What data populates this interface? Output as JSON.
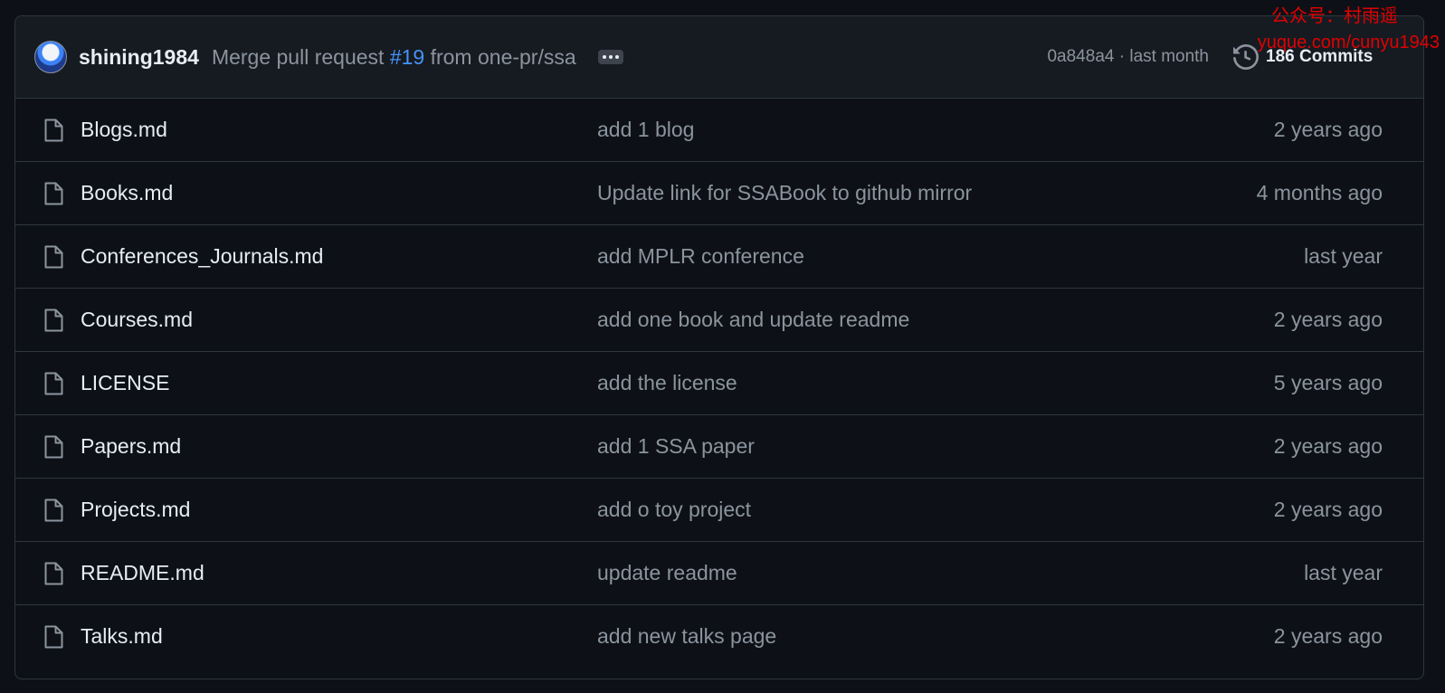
{
  "latest_commit": {
    "author": "shining1984",
    "message_prefix": "Merge pull request",
    "pr_number": "#19",
    "message_suffix": "from one-pr/ssa",
    "sha": "0a848a4",
    "separator": " · ",
    "time": "last month",
    "commits_label": "186 Commits"
  },
  "files": [
    {
      "name": "Blogs.md",
      "commit": "add 1 blog",
      "date": "2 years ago"
    },
    {
      "name": "Books.md",
      "commit": "Update link for SSABook to github mirror",
      "date": "4 months ago"
    },
    {
      "name": "Conferences_Journals.md",
      "commit": "add MPLR conference",
      "date": "last year"
    },
    {
      "name": "Courses.md",
      "commit": "add one book and update readme",
      "date": "2 years ago"
    },
    {
      "name": "LICENSE",
      "commit": "add the license",
      "date": "5 years ago"
    },
    {
      "name": "Papers.md",
      "commit": "add 1 SSA paper",
      "date": "2 years ago"
    },
    {
      "name": "Projects.md",
      "commit": "add o toy project",
      "date": "2 years ago"
    },
    {
      "name": "README.md",
      "commit": "update readme",
      "date": "last year"
    },
    {
      "name": "Talks.md",
      "commit": "add new talks page",
      "date": "2 years ago"
    }
  ],
  "watermark": {
    "line1": "公众号：村雨遥",
    "line2": "yuque.com/cunyu1943"
  },
  "icons": {
    "file": "file-icon",
    "history": "history-icon",
    "ellipsis": "ellipsis-icon"
  },
  "colors": {
    "background": "#0d1117",
    "header": "#161b22",
    "border": "#30363d",
    "link": "#4493f8",
    "muted": "#8b949e",
    "watermark": "#e10000"
  }
}
